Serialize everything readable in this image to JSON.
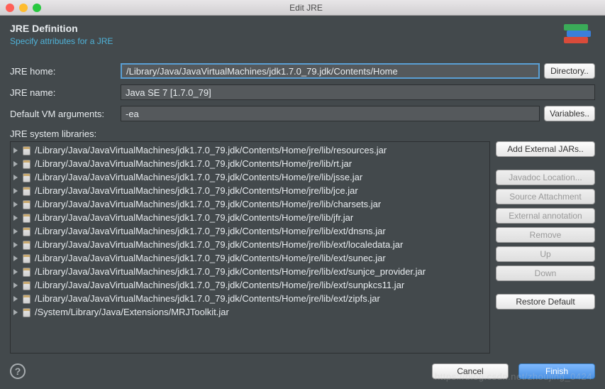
{
  "window": {
    "title": "Edit JRE"
  },
  "header": {
    "title": "JRE Definition",
    "subtitle": "Specify attributes for a JRE"
  },
  "fields": {
    "jre_home_label": "JRE home:",
    "jre_home_value": "/Library/Java/JavaVirtualMachines/jdk1.7.0_79.jdk/Contents/Home",
    "directory_btn": "Directory..",
    "jre_name_label": "JRE name:",
    "jre_name_value": "Java SE 7 [1.7.0_79]",
    "vm_args_label": "Default VM arguments:",
    "vm_args_value": "-ea",
    "variables_btn": "Variables..",
    "libraries_label": "JRE system libraries:"
  },
  "libraries": [
    "/Library/Java/JavaVirtualMachines/jdk1.7.0_79.jdk/Contents/Home/jre/lib/resources.jar",
    "/Library/Java/JavaVirtualMachines/jdk1.7.0_79.jdk/Contents/Home/jre/lib/rt.jar",
    "/Library/Java/JavaVirtualMachines/jdk1.7.0_79.jdk/Contents/Home/jre/lib/jsse.jar",
    "/Library/Java/JavaVirtualMachines/jdk1.7.0_79.jdk/Contents/Home/jre/lib/jce.jar",
    "/Library/Java/JavaVirtualMachines/jdk1.7.0_79.jdk/Contents/Home/jre/lib/charsets.jar",
    "/Library/Java/JavaVirtualMachines/jdk1.7.0_79.jdk/Contents/Home/jre/lib/jfr.jar",
    "/Library/Java/JavaVirtualMachines/jdk1.7.0_79.jdk/Contents/Home/jre/lib/ext/dnsns.jar",
    "/Library/Java/JavaVirtualMachines/jdk1.7.0_79.jdk/Contents/Home/jre/lib/ext/localedata.jar",
    "/Library/Java/JavaVirtualMachines/jdk1.7.0_79.jdk/Contents/Home/jre/lib/ext/sunec.jar",
    "/Library/Java/JavaVirtualMachines/jdk1.7.0_79.jdk/Contents/Home/jre/lib/ext/sunjce_provider.jar",
    "/Library/Java/JavaVirtualMachines/jdk1.7.0_79.jdk/Contents/Home/jre/lib/ext/sunpkcs11.jar",
    "/Library/Java/JavaVirtualMachines/jdk1.7.0_79.jdk/Contents/Home/jre/lib/ext/zipfs.jar",
    "/System/Library/Java/Extensions/MRJToolkit.jar"
  ],
  "lib_buttons": {
    "add_external": "Add External JARs..",
    "javadoc": "Javadoc Location...",
    "source": "Source Attachment",
    "annotation": "External annotation",
    "remove": "Remove",
    "up": "Up",
    "down": "Down",
    "restore": "Restore Default"
  },
  "footer": {
    "cancel": "Cancel",
    "finish": "Finish"
  },
  "watermark": "https://blog.csdn.net/zhoujing_0424"
}
